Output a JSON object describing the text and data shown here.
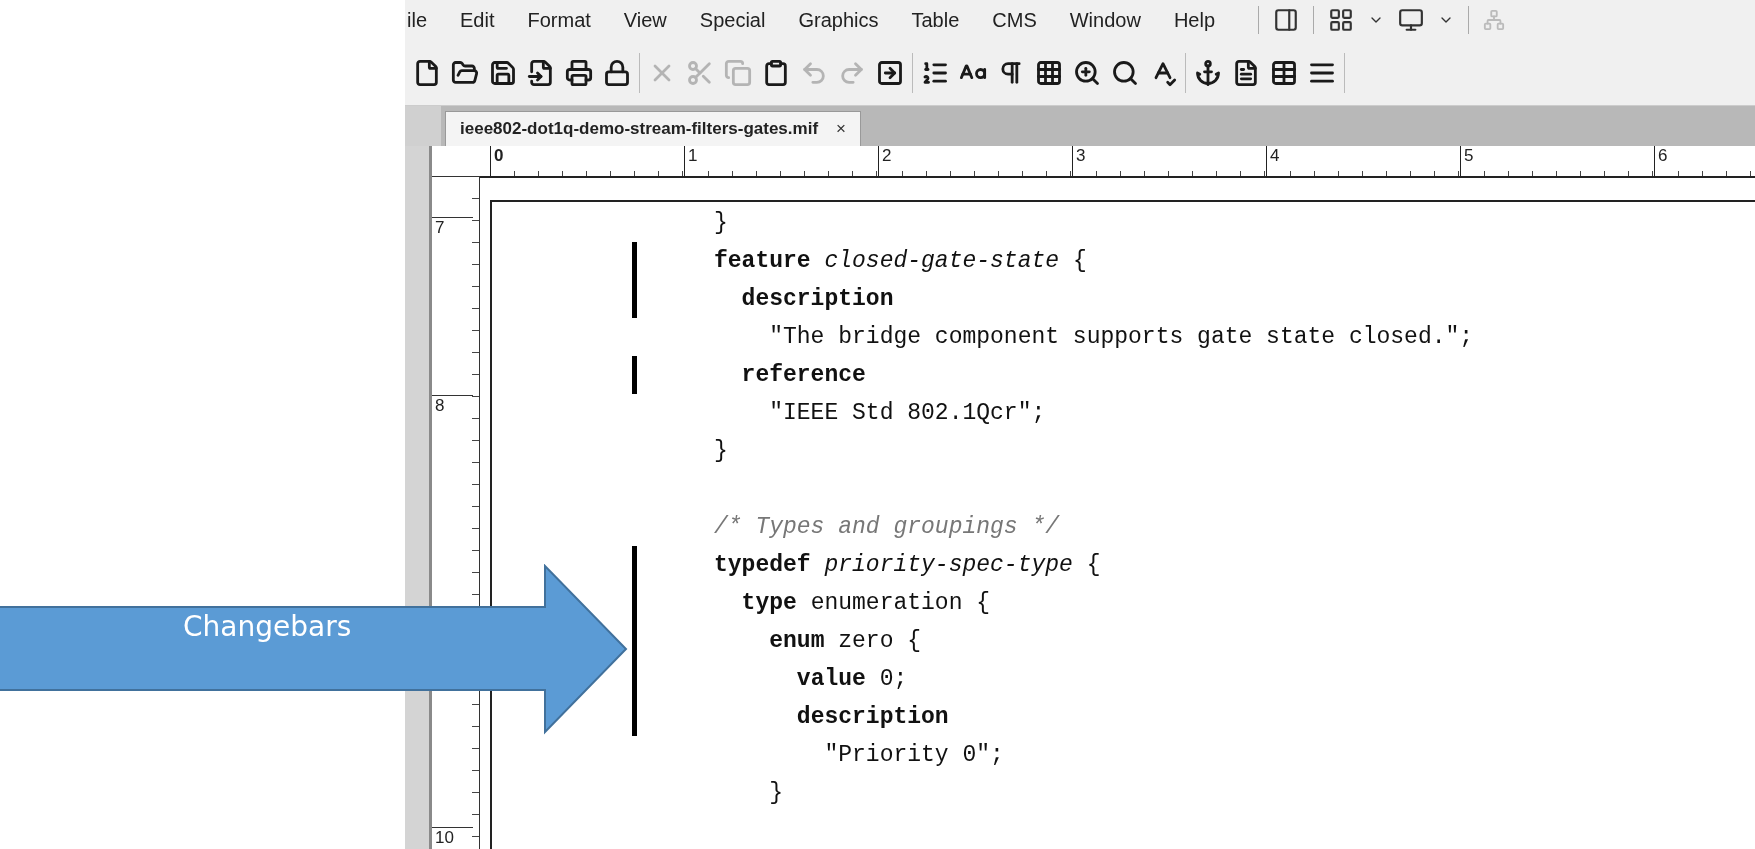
{
  "menu": [
    "ile",
    "Edit",
    "Format",
    "View",
    "Special",
    "Graphics",
    "Table",
    "CMS",
    "Window",
    "Help"
  ],
  "toolbar": [
    [
      {
        "disabled": false
      },
      {
        "disabled": false
      },
      {
        "disabled": false
      },
      {
        "disabled": false
      },
      {
        "disabled": false
      },
      {
        "disabled": false
      }
    ],
    [
      {
        "disabled": true
      },
      {
        "disabled": true
      },
      {
        "disabled": true
      },
      {
        "disabled": false
      },
      {
        "disabled": true
      },
      {
        "disabled": true
      },
      {
        "disabled": false
      }
    ],
    [
      {
        "disabled": false
      },
      {
        "disabled": false
      },
      {
        "disabled": false
      },
      {
        "disabled": false
      },
      {
        "disabled": false
      },
      {
        "disabled": false
      },
      {
        "disabled": false
      }
    ],
    [
      {
        "disabled": false
      },
      {
        "disabled": false
      },
      {
        "disabled": false
      },
      {
        "disabled": false
      }
    ]
  ],
  "tab": {
    "title": "ieee802-dot1q-demo-stream-filters-gates.mif",
    "close": "×"
  },
  "ruler": {
    "marks": [
      "0",
      "1",
      "2",
      "3",
      "4",
      "5",
      "6"
    ],
    "vertical_marks": [
      "7",
      "8",
      "10"
    ]
  },
  "lines": [
    {
      "kind": "code",
      "text": "}",
      "changebar": false
    },
    {
      "kind": "code",
      "text": "**feature** *closed-gate-state* {",
      "changebar": true
    },
    {
      "kind": "code",
      "text": "  **description**",
      "changebar": true
    },
    {
      "kind": "code",
      "text": "    \"The bridge component supports gate state closed.\";",
      "changebar": false
    },
    {
      "kind": "code",
      "text": "  **reference**",
      "changebar": true
    },
    {
      "kind": "code",
      "text": "    \"IEEE Std 802.1Qcr\";",
      "changebar": false
    },
    {
      "kind": "code",
      "text": "}",
      "changebar": false
    },
    {
      "kind": "blank",
      "changebar": false
    },
    {
      "kind": "comment",
      "text": "/* Types and groupings */",
      "changebar": false
    },
    {
      "kind": "code",
      "text": "**typedef** *priority-spec-type* {",
      "changebar": true
    },
    {
      "kind": "code",
      "text": "  **type** enumeration {",
      "changebar": true
    },
    {
      "kind": "code",
      "text": "    **enum** zero {",
      "changebar": true
    },
    {
      "kind": "code",
      "text": "      **value** 0;",
      "changebar": true
    },
    {
      "kind": "code",
      "text": "      **description**",
      "changebar": true
    },
    {
      "kind": "code",
      "text": "        \"Priority 0\";",
      "changebar": false
    },
    {
      "kind": "code",
      "text": "    }",
      "changebar": false
    }
  ],
  "annotation": {
    "label": "Changebars"
  }
}
